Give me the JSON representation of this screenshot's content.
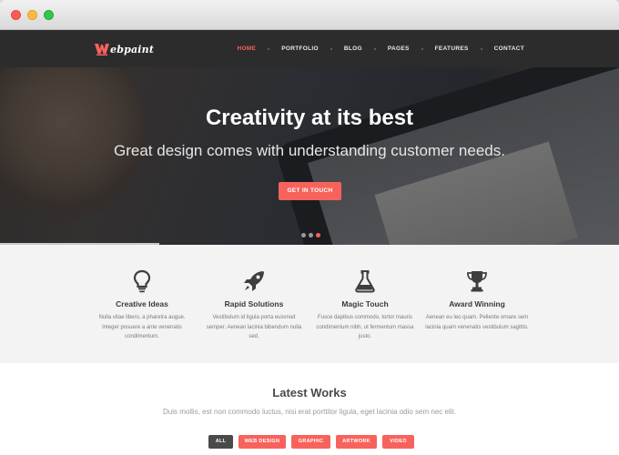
{
  "window": {
    "controls": [
      "close",
      "minimize",
      "zoom"
    ]
  },
  "brand": {
    "logo_text": "ebpaint",
    "accent": "#f7635c"
  },
  "nav": {
    "items": [
      {
        "label": "HOME",
        "active": true
      },
      {
        "label": "PORTFOLIO",
        "active": false
      },
      {
        "label": "BLOG",
        "active": false
      },
      {
        "label": "PAGES",
        "active": false
      },
      {
        "label": "FEATURES",
        "active": false
      },
      {
        "label": "CONTACT",
        "active": false
      }
    ]
  },
  "hero": {
    "title": "Creativity at its best",
    "subtitle": "Great design comes with understanding customer needs.",
    "cta_label": "GET IN TOUCH",
    "slides_count": 3,
    "active_slide": 3
  },
  "features": [
    {
      "icon": "lightbulb-icon",
      "title": "Creative Ideas",
      "text": "Nulla vitae libero, a pharetra augue. Integer posuere a ante venenatis condimentum."
    },
    {
      "icon": "rocket-icon",
      "title": "Rapid Solutions",
      "text": "Vestibulum id ligula porta euismod semper. Aenean lacinia bibendum nulla sed."
    },
    {
      "icon": "flask-icon",
      "title": "Magic Touch",
      "text": "Fusce dapibus commodo, tortor mauris condimentum nibh, ut fermentum massa justo."
    },
    {
      "icon": "trophy-icon",
      "title": "Award Winning",
      "text": "Aenean eu leo quam. Pellente ornare sem lacinia quam venenatis vestibulum sagittis."
    }
  ],
  "works": {
    "title": "Latest Works",
    "description": "Duis mollis, est non commodo luctus, nisi erat porttitor ligula, eget lacinia odio sem nec elit.",
    "filters": [
      {
        "label": "ALL",
        "active": true
      },
      {
        "label": "WEB DESIGN",
        "active": false
      },
      {
        "label": "GRAPHIC",
        "active": false
      },
      {
        "label": "ARTWORK",
        "active": false
      },
      {
        "label": "VIDEO",
        "active": false
      }
    ]
  }
}
